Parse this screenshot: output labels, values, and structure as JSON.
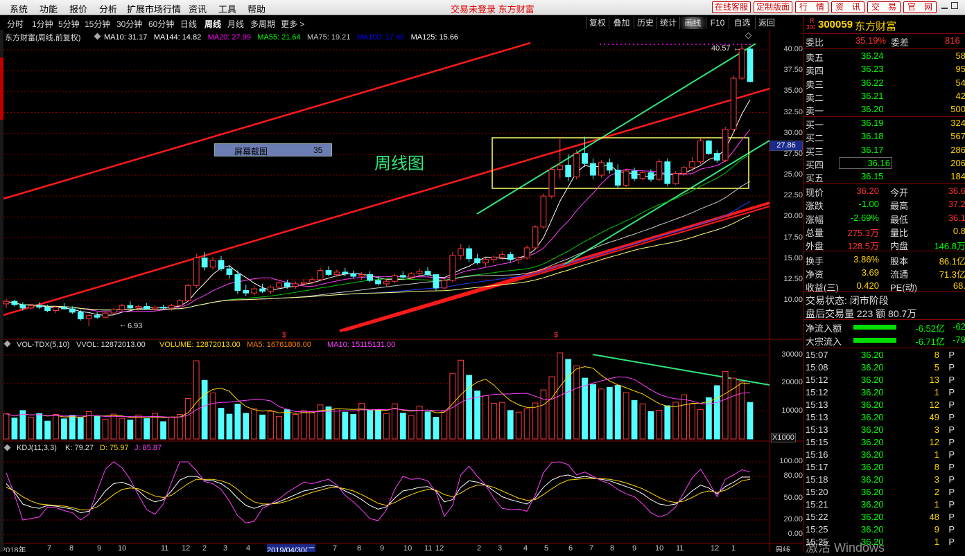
{
  "menu": {
    "items": [
      "系统",
      "功能",
      "报价",
      "分析",
      "扩展市场行情",
      "资讯",
      "工具",
      "帮助"
    ],
    "status": "交易未登录  东方财富",
    "right_buttons": [
      "在线客服",
      "定制版面",
      "行　情",
      "资　讯",
      "交　易",
      "官　网"
    ]
  },
  "periods": [
    "分时",
    "1分钟",
    "5分钟",
    "15分钟",
    "30分钟",
    "60分钟",
    "日线",
    "周线",
    "月线",
    "多周期",
    "更多 >"
  ],
  "active_period": "周线",
  "tools": [
    "复权",
    "叠加",
    "历史",
    "统计",
    "画线",
    "F10",
    "自选",
    "返回"
  ],
  "main_chart": {
    "title": "东方财富(周线,前复权)",
    "mas": [
      {
        "text": "MA10: 31.17",
        "color": "#ffffff"
      },
      {
        "text": "MA144: 14.82",
        "color": "#ffffff"
      },
      {
        "text": "MA20: 27.99",
        "color": "#ff00ff"
      },
      {
        "text": "MA55: 21.64",
        "color": "#00ff00"
      },
      {
        "text": "MA75: 19.21",
        "color": "#c8c8c8"
      },
      {
        "text": "MA100: 17.40",
        "color": "#0000ff"
      },
      {
        "text": "MA125: 15.66",
        "color": "#ffffff"
      }
    ],
    "annotation": "周线图",
    "screenshot_label": "屏幕截图",
    "screenshot_number": "35",
    "high_label": "40.57",
    "low_label": "6.93",
    "current_price": "27.86",
    "s_markers": [
      "$",
      "$"
    ]
  },
  "chart_data": [
    {
      "type": "candlestick",
      "name": "price",
      "yticks": [
        40.0,
        37.5,
        35.0,
        32.5,
        30.0,
        27.5,
        25.0,
        22.5,
        20.0,
        17.5,
        15.0,
        12.5,
        10.0
      ],
      "ylim": [
        7.0,
        41.0
      ],
      "ohlc": [
        [
          9.6,
          10.2,
          9.1,
          9.9
        ],
        [
          9.9,
          10.1,
          9.3,
          9.5
        ],
        [
          9.5,
          9.8,
          8.8,
          9.1
        ],
        [
          9.1,
          9.6,
          8.9,
          9.4
        ],
        [
          9.4,
          9.8,
          9.0,
          9.2
        ],
        [
          9.2,
          9.5,
          8.6,
          8.8
        ],
        [
          8.8,
          9.4,
          8.5,
          9.2
        ],
        [
          9.2,
          9.7,
          8.9,
          9.0
        ],
        [
          9.0,
          9.3,
          8.4,
          8.6
        ],
        [
          8.6,
          8.9,
          7.6,
          7.8
        ],
        [
          7.8,
          8.4,
          6.93,
          8.2
        ],
        [
          8.2,
          8.6,
          7.8,
          8.0
        ],
        [
          8.0,
          8.7,
          7.9,
          8.5
        ],
        [
          8.5,
          9.1,
          8.3,
          8.9
        ],
        [
          8.9,
          9.6,
          8.7,
          9.4
        ],
        [
          9.4,
          9.9,
          9.0,
          9.1
        ],
        [
          9.1,
          9.5,
          8.8,
          9.3
        ],
        [
          9.3,
          9.7,
          8.9,
          9.0
        ],
        [
          9.0,
          9.4,
          8.7,
          9.2
        ],
        [
          9.2,
          9.5,
          8.9,
          9.1
        ],
        [
          9.1,
          9.6,
          8.8,
          9.4
        ],
        [
          9.4,
          10.2,
          9.2,
          10.0
        ],
        [
          10.0,
          12.0,
          9.8,
          11.8
        ],
        [
          11.8,
          15.6,
          11.5,
          15.1
        ],
        [
          15.1,
          15.8,
          13.6,
          14.0
        ],
        [
          14.0,
          15.2,
          13.7,
          14.8
        ],
        [
          14.8,
          15.3,
          13.5,
          13.8
        ],
        [
          13.8,
          14.2,
          12.6,
          13.1
        ],
        [
          13.1,
          13.6,
          10.8,
          11.2
        ],
        [
          11.2,
          11.9,
          10.5,
          10.9
        ],
        [
          10.9,
          11.7,
          10.6,
          11.4
        ],
        [
          11.4,
          12.0,
          10.9,
          11.1
        ],
        [
          11.1,
          11.8,
          10.8,
          11.6
        ],
        [
          11.6,
          12.4,
          11.3,
          12.1
        ],
        [
          12.1,
          12.5,
          11.4,
          11.7
        ],
        [
          11.7,
          12.3,
          11.4,
          12.0
        ],
        [
          12.0,
          12.6,
          11.7,
          12.2
        ],
        [
          12.2,
          12.8,
          11.9,
          12.5
        ],
        [
          12.5,
          13.9,
          12.3,
          13.6
        ],
        [
          13.6,
          14.1,
          12.9,
          13.1
        ],
        [
          13.1,
          13.7,
          12.8,
          13.4
        ],
        [
          13.4,
          13.9,
          12.9,
          13.2
        ],
        [
          13.2,
          13.6,
          12.6,
          12.9
        ],
        [
          12.9,
          13.4,
          12.5,
          13.1
        ],
        [
          13.1,
          13.5,
          12.2,
          12.4
        ],
        [
          12.4,
          12.9,
          11.8,
          12.0
        ],
        [
          12.0,
          12.6,
          11.7,
          12.3
        ],
        [
          12.3,
          13.2,
          12.1,
          13.0
        ],
        [
          13.0,
          13.5,
          12.6,
          12.8
        ],
        [
          12.8,
          13.4,
          12.5,
          13.2
        ],
        [
          13.2,
          13.8,
          12.9,
          13.5
        ],
        [
          13.5,
          14.0,
          12.9,
          13.1
        ],
        [
          13.1,
          12.4,
          11.2,
          11.5
        ],
        [
          11.5,
          12.6,
          11.3,
          12.4
        ],
        [
          12.4,
          15.8,
          12.2,
          15.4
        ],
        [
          15.4,
          16.8,
          14.9,
          16.2
        ],
        [
          16.2,
          16.6,
          14.6,
          15.0
        ],
        [
          15.0,
          15.6,
          14.3,
          14.5
        ],
        [
          14.5,
          15.1,
          14.1,
          14.9
        ],
        [
          14.9,
          15.4,
          14.5,
          15.2
        ],
        [
          15.2,
          15.9,
          14.8,
          15.5
        ],
        [
          15.5,
          15.8,
          14.6,
          14.9
        ],
        [
          14.9,
          15.3,
          14.4,
          15.1
        ],
        [
          15.1,
          16.6,
          14.9,
          16.3
        ],
        [
          16.3,
          19.0,
          16.1,
          18.8
        ],
        [
          18.8,
          22.8,
          18.6,
          22.5
        ],
        [
          22.5,
          26.0,
          22.2,
          25.7
        ],
        [
          25.7,
          29.5,
          24.6,
          26.2
        ],
        [
          26.2,
          27.5,
          24.3,
          24.8
        ],
        [
          24.8,
          28.0,
          24.5,
          27.6
        ],
        [
          27.6,
          29.6,
          26.0,
          26.4
        ],
        [
          26.4,
          27.0,
          24.5,
          25.0
        ],
        [
          25.0,
          26.8,
          24.7,
          26.5
        ],
        [
          26.5,
          27.0,
          25.2,
          25.6
        ],
        [
          25.6,
          26.3,
          23.4,
          23.8
        ],
        [
          23.8,
          25.8,
          23.6,
          25.5
        ],
        [
          25.5,
          25.9,
          24.3,
          24.6
        ],
        [
          24.6,
          25.6,
          24.4,
          25.3
        ],
        [
          25.3,
          25.7,
          24.2,
          24.5
        ],
        [
          24.5,
          26.9,
          24.3,
          26.6
        ],
        [
          26.6,
          27.0,
          23.7,
          24.0
        ],
        [
          24.0,
          25.5,
          23.8,
          25.2
        ],
        [
          25.2,
          26.1,
          24.9,
          25.9
        ],
        [
          25.9,
          27.2,
          25.5,
          26.6
        ],
        [
          26.6,
          29.4,
          26.3,
          29.1
        ],
        [
          29.1,
          29.2,
          27.4,
          27.6
        ],
        [
          27.6,
          28.0,
          26.5,
          26.8
        ],
        [
          26.8,
          30.8,
          26.6,
          30.5
        ],
        [
          30.5,
          36.9,
          30.3,
          36.6
        ],
        [
          36.6,
          40.57,
          36.4,
          40.1
        ],
        [
          40.1,
          40.3,
          36.1,
          36.2
        ]
      ]
    },
    {
      "type": "bar",
      "name": "VOL-TDX(5,10)",
      "title": "VOL-TDX(5,10)",
      "legend": [
        "VVOL: 12872013.00",
        "VOLUME: 12872013.00",
        "MA5: 16761806.00",
        "MA10: 15115131.00"
      ],
      "yticks": [
        30000,
        20000,
        10000
      ],
      "unit": "X1000",
      "ylim": [
        0,
        32000
      ],
      "values": [
        9000,
        7500,
        10200,
        7800,
        9100,
        6400,
        8800,
        7200,
        8500,
        7600,
        9800,
        8200,
        7100,
        8900,
        7400,
        6800,
        8600,
        7300,
        9200,
        6200,
        7900,
        8800,
        14500,
        28000,
        21000,
        16500,
        11000,
        8900,
        12500,
        9200,
        10800,
        8600,
        9900,
        8100,
        10500,
        8800,
        10200,
        9400,
        12200,
        11500,
        10800,
        9600,
        8800,
        12800,
        10200,
        10400,
        9100,
        12600,
        9300,
        8400,
        11800,
        9700,
        7800,
        10200,
        23500,
        28200,
        22800,
        17200,
        15500,
        12800,
        13100,
        10200,
        9600,
        10800,
        12900,
        17600,
        22300,
        30800,
        28500,
        26200,
        21800,
        19500,
        17900,
        18500,
        19200,
        16600,
        13800,
        12600,
        9800,
        10300,
        11900,
        13200,
        15800,
        12600,
        10500,
        14800,
        19100,
        24200,
        21800,
        20500,
        13100
      ]
    },
    {
      "type": "line",
      "name": "KDJ(11,3,3)",
      "title": "KDJ(11,3,3)",
      "legend": [
        "K: 79.27",
        "D: 75.97",
        "J: 85.87"
      ],
      "yticks": [
        100.0,
        80.0,
        50.0,
        20.0,
        0.0
      ],
      "ylim": [
        -5,
        108
      ],
      "series": [
        {
          "name": "K",
          "values": [
            70,
            58,
            42,
            38,
            36,
            40,
            39,
            37,
            35,
            30,
            32,
            45,
            60,
            70,
            72,
            68,
            60,
            50,
            45,
            48,
            60,
            75,
            80,
            80,
            75,
            74,
            70,
            62,
            50,
            40,
            36,
            40,
            42,
            45,
            50,
            55,
            60,
            62,
            65,
            68,
            66,
            60,
            55,
            48,
            40,
            35,
            38,
            50,
            60,
            62,
            65,
            66,
            60,
            45,
            48,
            65,
            74,
            72,
            68,
            60,
            52,
            48,
            45,
            42,
            50,
            65,
            75,
            80,
            82,
            78,
            80,
            78,
            76,
            74,
            70,
            66,
            62,
            56,
            48,
            42,
            40,
            42,
            50,
            60,
            68,
            64,
            56,
            66,
            72,
            79,
            79
          ]
        },
        {
          "name": "D",
          "values": [
            65,
            60,
            52,
            46,
            42,
            41,
            40,
            39,
            37,
            34,
            34,
            38,
            46,
            55,
            62,
            64,
            63,
            58,
            53,
            51,
            54,
            62,
            70,
            76,
            76,
            76,
            74,
            70,
            62,
            52,
            45,
            42,
            42,
            43,
            46,
            50,
            54,
            58,
            61,
            64,
            65,
            63,
            60,
            55,
            49,
            43,
            40,
            44,
            50,
            55,
            59,
            62,
            61,
            55,
            52,
            57,
            64,
            68,
            68,
            65,
            60,
            55,
            50,
            47,
            48,
            55,
            63,
            70,
            75,
            76,
            77,
            77,
            77,
            76,
            74,
            71,
            67,
            63,
            57,
            51,
            46,
            44,
            46,
            51,
            57,
            60,
            58,
            61,
            67,
            74,
            76
          ]
        },
        {
          "name": "J",
          "values": [
            85,
            55,
            20,
            22,
            24,
            38,
            37,
            33,
            30,
            20,
            28,
            60,
            90,
            100,
            92,
            76,
            54,
            34,
            28,
            42,
            72,
            100,
            100,
            88,
            73,
            70,
            62,
            46,
            26,
            16,
            18,
            36,
            42,
            49,
            58,
            65,
            72,
            70,
            73,
            76,
            68,
            54,
            45,
            34,
            22,
            19,
            34,
            62,
            80,
            76,
            77,
            74,
            58,
            25,
            40,
            82,
            94,
            80,
            68,
            50,
            36,
            34,
            35,
            32,
            54,
            85,
            99,
            100,
            96,
            82,
            86,
            80,
            74,
            70,
            62,
            56,
            52,
            42,
            30,
            24,
            28,
            38,
            58,
            78,
            90,
            72,
            52,
            76,
            82,
            89,
            86
          ]
        }
      ]
    }
  ],
  "xaxis_labels": [
    "2018年",
    "7",
    "8",
    "9",
    "10",
    "11",
    "12",
    "2",
    "3",
    "4",
    "2019/04/30(二",
    "7",
    "8",
    "9",
    "10",
    "11",
    "12",
    "2",
    "3",
    "4",
    "5",
    "6",
    "7",
    "8",
    "9",
    "10",
    "11",
    "12",
    "1",
    "周线"
  ],
  "quote": {
    "badge": "R",
    "badge_num": "300",
    "code": "300059",
    "name": "东方财富",
    "weibi": {
      "label": "委比",
      "value": "35.19%",
      "label2": "委差",
      "value2": "816"
    },
    "sell": [
      [
        "卖五",
        "36.24",
        "58"
      ],
      [
        "卖四",
        "36.23",
        "95"
      ],
      [
        "卖三",
        "36.22",
        "54"
      ],
      [
        "卖二",
        "36.21",
        "42"
      ],
      [
        "卖一",
        "36.20",
        "500"
      ]
    ],
    "buy": [
      [
        "买一",
        "36.19",
        "324"
      ],
      [
        "买二",
        "36.18",
        "567"
      ],
      [
        "买三",
        "36.17",
        "286"
      ],
      [
        "买四",
        "36.16",
        "206"
      ],
      [
        "买五",
        "36.15",
        "184"
      ]
    ],
    "stats": [
      [
        "现价",
        "36.20",
        "今开",
        "36.6"
      ],
      [
        "涨跌",
        "-1.00",
        "最高",
        "37.2"
      ],
      [
        "涨幅",
        "-2.69%",
        "最低",
        "36.1"
      ],
      [
        "总量",
        "275.3万",
        "量比",
        "0.8"
      ],
      [
        "外盘",
        "128.5万",
        "内盘",
        "146.8万"
      ],
      [
        "换手",
        "3.86%",
        "股本",
        "86.1亿"
      ],
      [
        "净资",
        "3.69",
        "流通",
        "71.3亿"
      ],
      [
        "收益(三)",
        "0.420",
        "PE(动)",
        "68."
      ]
    ],
    "trade_status": "交易状态: 闭市阶段",
    "after_hours": "盘后交易量 223 额 80.7万",
    "flows": [
      [
        "净流入额",
        "-6.52亿",
        "-62"
      ],
      [
        "大宗流入",
        "-6.71亿",
        "-79"
      ]
    ],
    "ticks": [
      [
        "15:07",
        "36.20",
        "8",
        "P"
      ],
      [
        "15:08",
        "36.20",
        "5",
        "P"
      ],
      [
        "15:12",
        "36.20",
        "13",
        "P"
      ],
      [
        "15:12",
        "36.20",
        "1",
        "P"
      ],
      [
        "15:13",
        "36.20",
        "12",
        "P"
      ],
      [
        "15:13",
        "36.20",
        "49",
        "P"
      ],
      [
        "15:13",
        "36.20",
        "3",
        "P"
      ],
      [
        "15:15",
        "36.20",
        "12",
        "P"
      ],
      [
        "15:16",
        "36.20",
        "1",
        "P"
      ],
      [
        "15:17",
        "36.20",
        "8",
        "P"
      ],
      [
        "15:18",
        "36.20",
        "3",
        "P"
      ],
      [
        "15:20",
        "36.20",
        "2",
        "P"
      ],
      [
        "15:21",
        "36.20",
        "1",
        "P"
      ],
      [
        "15:22",
        "36.20",
        "48",
        "P"
      ],
      [
        "15:25",
        "36.20",
        "9",
        "P"
      ],
      [
        "15:25",
        "36.20",
        "1",
        "P"
      ]
    ],
    "watermark": "激活 Windows"
  }
}
